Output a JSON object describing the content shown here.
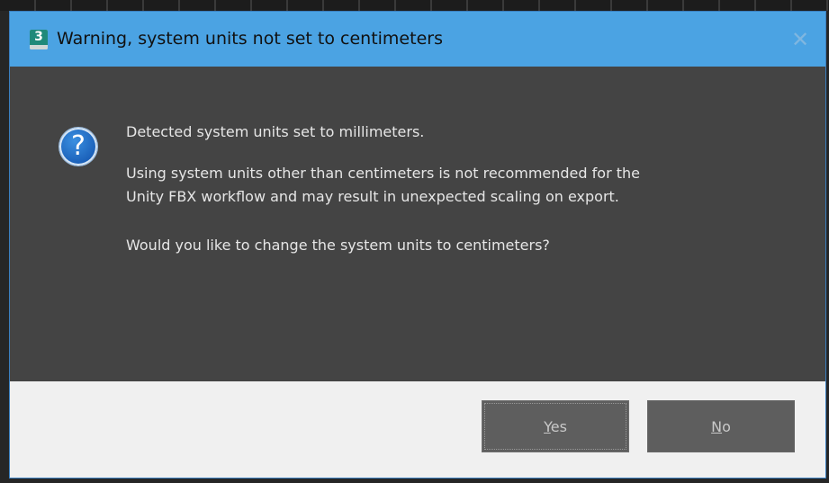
{
  "dialog": {
    "title": "Warning, system units not set to centimeters",
    "app_icon": {
      "name": "3ds-max-icon",
      "glyph": "3"
    },
    "close_glyph": "✕",
    "icon": "question-icon",
    "icon_glyph": "?",
    "messages": [
      "Detected system units set to millimeters.",
      "Using system units other than centimeters is not recommended for the",
      "Unity FBX workflow and may result in unexpected scaling on export.",
      "Would you like to change the system units to centimeters?"
    ],
    "buttons": {
      "yes": {
        "mnemonic": "Y",
        "rest": "es"
      },
      "no": {
        "mnemonic": "N",
        "rest": "o"
      }
    }
  },
  "colors": {
    "titlebar": "#4ba3e3",
    "body": "#444444",
    "footer": "#f0f0f0",
    "button": "#5e5e5e"
  }
}
